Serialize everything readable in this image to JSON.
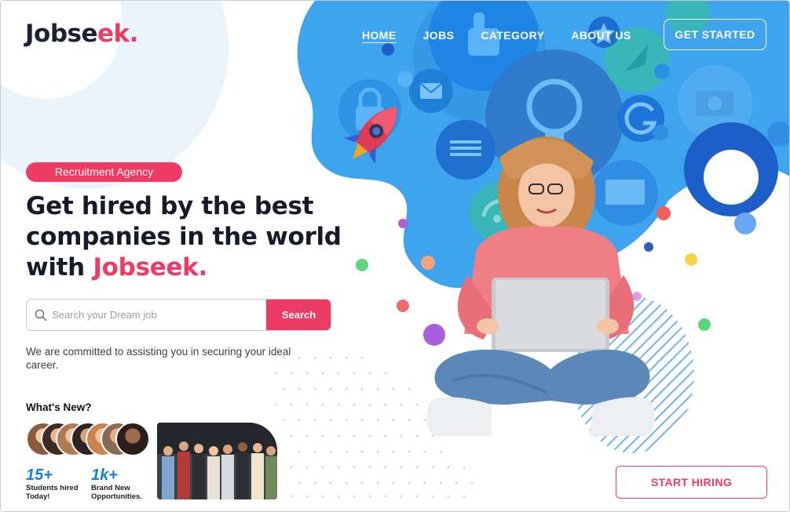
{
  "logo": {
    "main": "Jobse",
    "accent": "ek."
  },
  "nav": {
    "items": [
      {
        "label": "HOME",
        "active": true
      },
      {
        "label": "JOBS",
        "active": false
      },
      {
        "label": "CATEGORY",
        "active": false
      },
      {
        "label": "ABOUT US",
        "active": false
      }
    ],
    "cta_label": "GET STARTED"
  },
  "hero": {
    "badge": "Recruitment Agency",
    "headline_line1": "Get hired by the best",
    "headline_line2": "companies in the world",
    "headline_line3_prefix": "with ",
    "headline_line3_accent": "Jobseek.",
    "search_placeholder": "Search your Dream job",
    "search_value": "",
    "search_button": "Search",
    "commitment": "We are committed to assisting you in securing your ideal career."
  },
  "whats_new": {
    "title": "What's New?",
    "stats": [
      {
        "number": "15+",
        "label_line1": "Students hired",
        "label_line2": "Today!"
      },
      {
        "number": "1k+",
        "label_line1": "Brand New",
        "label_line2": "Opportunities."
      }
    ]
  },
  "cta": {
    "start_hiring": "START HIRING"
  },
  "colors": {
    "accent": "#ee3b63",
    "blob_blue": "#3fa4ee",
    "dark_text": "#161b2a",
    "stat_blue": "#1580d6"
  },
  "icons": [
    "search-icon",
    "thumbs-up-icon",
    "mail-icon",
    "lightbulb-icon",
    "rocket-icon",
    "camera-icon",
    "wifi-icon",
    "document-icon",
    "google-icon",
    "laptop-icon",
    "star-icon",
    "lock-icon"
  ]
}
